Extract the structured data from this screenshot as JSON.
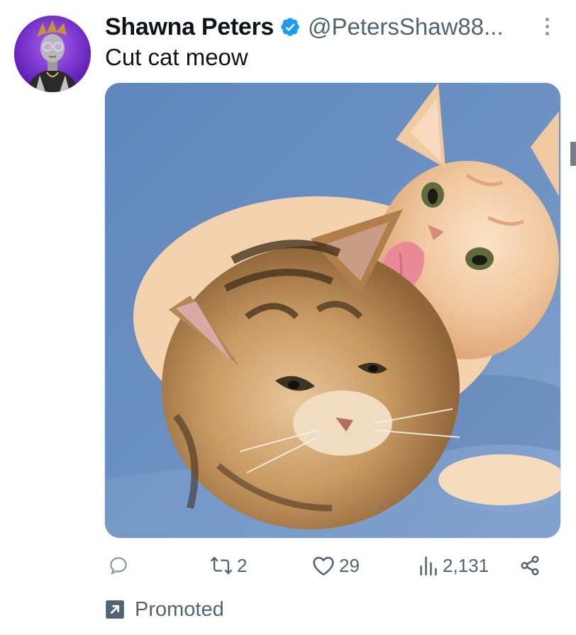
{
  "author": {
    "display_name": "Shawna Peters",
    "handle": "@PetersShaw88...",
    "verified": true
  },
  "tweet": {
    "text": "Cut cat meow"
  },
  "media": {
    "description_icon": "photo-two-kittens"
  },
  "actions": {
    "reply": {
      "icon": "reply-icon",
      "count": ""
    },
    "retweet": {
      "icon": "retweet-icon",
      "count": "2"
    },
    "like": {
      "icon": "heart-icon",
      "count": "29"
    },
    "views": {
      "icon": "views-icon",
      "count": "2,131"
    },
    "share": {
      "icon": "share-icon"
    }
  },
  "promoted": {
    "label": "Promoted",
    "icon": "promoted-arrow-icon"
  },
  "colors": {
    "text_primary": "#0f1419",
    "text_secondary": "#536471",
    "verified_blue": "#1d9bf0",
    "avatar_purple": "#7b2fd6"
  }
}
